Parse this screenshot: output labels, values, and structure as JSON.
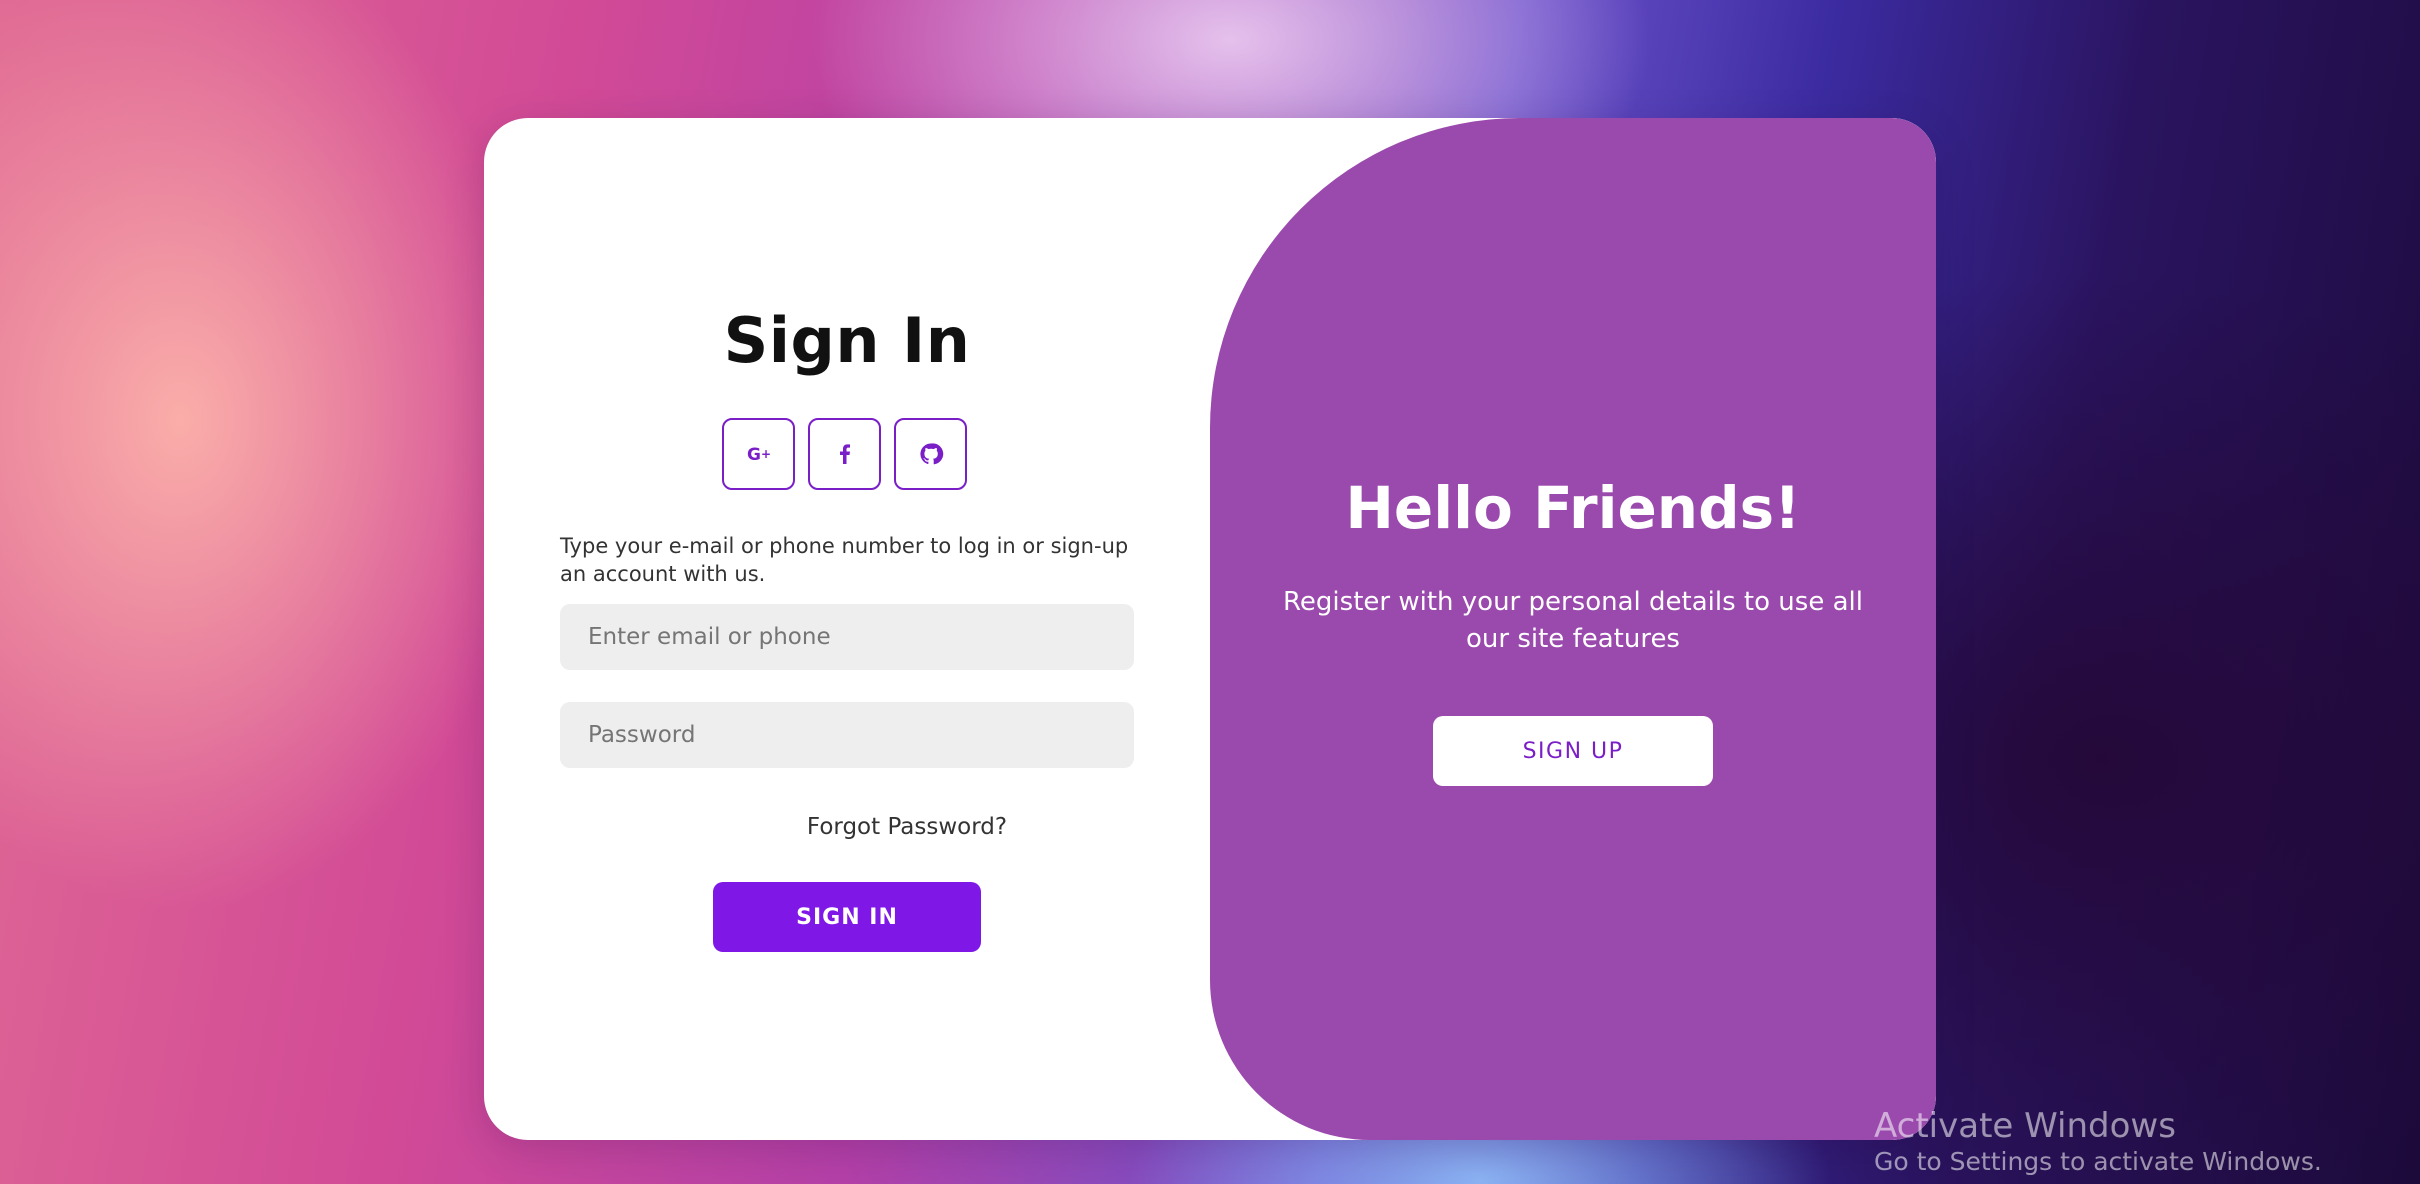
{
  "signin": {
    "title": "Sign In",
    "social": [
      {
        "name": "google-plus-icon"
      },
      {
        "name": "facebook-icon"
      },
      {
        "name": "github-icon"
      }
    ],
    "hint": "Type your e-mail or phone number to log in or sign-up an account with us.",
    "email_placeholder": "Enter email or phone",
    "email_value": "",
    "password_placeholder": "Password",
    "password_value": "",
    "forgot_label": "Forgot Password?",
    "button_label": "SIGN IN"
  },
  "welcome": {
    "title": "Hello Friends!",
    "text": "Register with your personal details to use all our site features",
    "button_label": "SIGN UP"
  },
  "watermark": {
    "title": "Activate Windows",
    "subtitle": "Go to Settings to activate Windows."
  },
  "colors": {
    "accent": "#7f18e6",
    "panel": "#9a49ad",
    "field_bg": "#eeeeee"
  }
}
